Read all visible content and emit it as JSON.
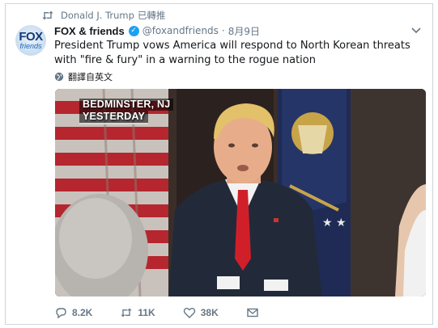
{
  "context": {
    "icon": "retweet-icon",
    "user": "Donald J. Trump",
    "action": "已轉推"
  },
  "tweet": {
    "display_name": "FOX & friends",
    "handle": "@foxandfriends",
    "separator": "·",
    "timestamp": "8月9日",
    "verified": true,
    "text": "President Trump vows America will respond to North Korean threats with \"fire & fury\" in a warning to the rogue nation",
    "translate_label": "翻譯自英文"
  },
  "avatar": {
    "line1": "FOX",
    "line2": "friends"
  },
  "media": {
    "chyron_line1": "BEDMINSTER, NJ",
    "chyron_line2": "YESTERDAY"
  },
  "actions": {
    "reply": {
      "icon": "reply-icon",
      "count": "8.2K"
    },
    "retweet": {
      "icon": "retweet-icon",
      "count": "11K"
    },
    "like": {
      "icon": "heart-icon",
      "count": "38K"
    },
    "message": {
      "icon": "envelope-icon"
    }
  },
  "colors": {
    "accent": "#1da1f2",
    "text": "#14171a",
    "secondary": "#657786",
    "border": "#cfd4d8"
  }
}
